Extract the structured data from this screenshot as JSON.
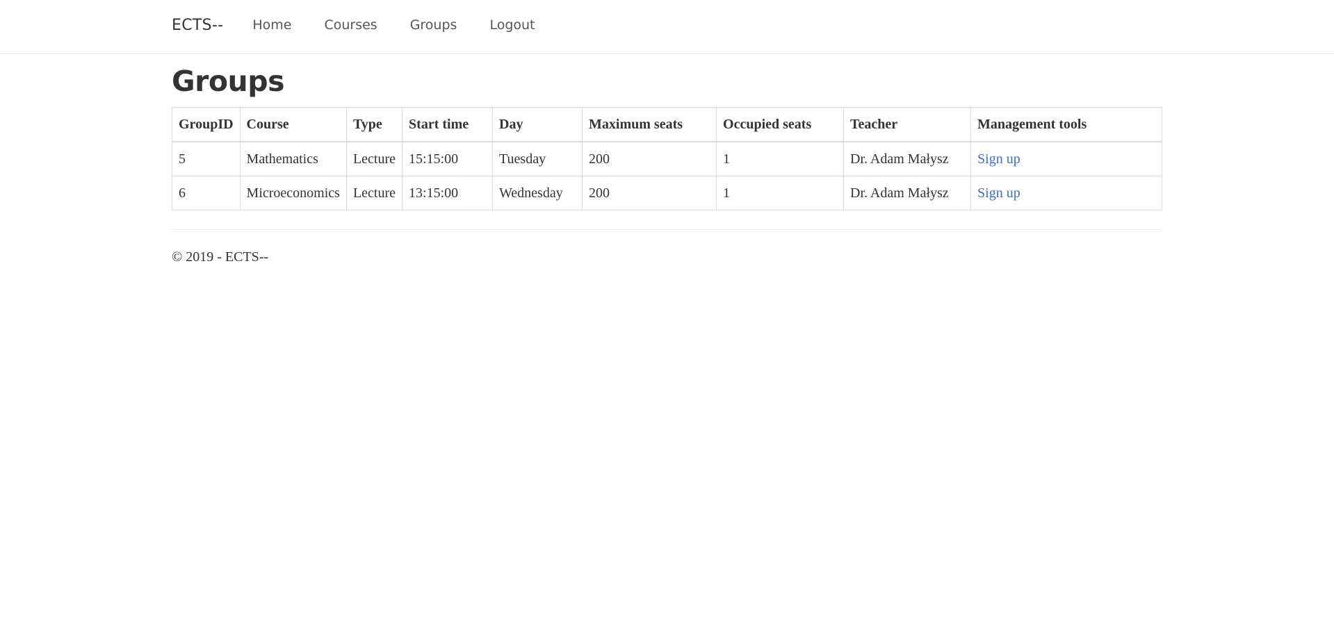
{
  "navbar": {
    "brand": "ECTS--",
    "links": [
      "Home",
      "Courses",
      "Groups",
      "Logout"
    ]
  },
  "page": {
    "title": "Groups"
  },
  "table": {
    "headers": [
      "GroupID",
      "Course",
      "Type",
      "Start time",
      "Day",
      "Maximum seats",
      "Occupied seats",
      "Teacher",
      "Management tools"
    ],
    "rows": [
      [
        "5",
        "Mathematics",
        "Lecture",
        "15:15:00",
        "Tuesday",
        "200",
        "1",
        "Dr. Adam Małysz",
        "Sign up"
      ],
      [
        "6",
        "Microeconomics",
        "Lecture",
        "13:15:00",
        "Wednesday",
        "200",
        "1",
        "Dr. Adam Małysz",
        "Sign up"
      ]
    ]
  },
  "footer": {
    "text": "© 2019 - ECTS--"
  },
  "colors": {
    "link": "#3a6bd6",
    "text": "#333333",
    "border": "#dddddd"
  }
}
